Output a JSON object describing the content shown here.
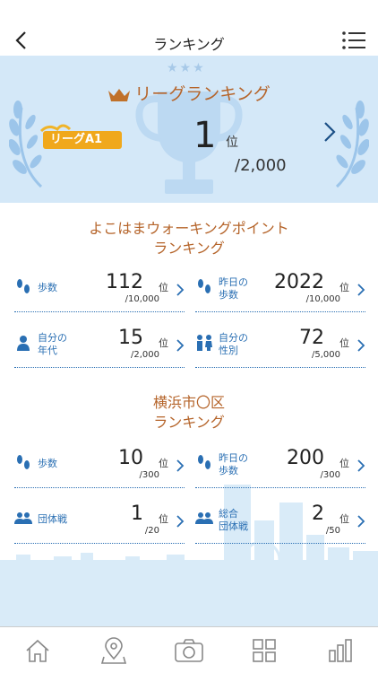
{
  "header": {
    "title": "ランキング"
  },
  "league": {
    "title": "リーグランキング",
    "badge": "リーグA1",
    "rank": "1",
    "rank_unit": "位",
    "total": "/2,000"
  },
  "section_yokohama": {
    "title_line1": "よこはまウォーキングポイント",
    "title_line2": "ランキング",
    "items": [
      {
        "label": "歩数",
        "value": "112",
        "unit": "位",
        "total": "/10,000",
        "icon": "footsteps-icon"
      },
      {
        "label_line1": "昨日の",
        "label_line2": "歩数",
        "value": "2022",
        "unit": "位",
        "total": "/10,000",
        "icon": "footsteps-icon"
      },
      {
        "label_line1": "自分の",
        "label_line2": "年代",
        "value": "15",
        "unit": "位",
        "total": "/2,000",
        "icon": "person-icon"
      },
      {
        "label_line1": "自分の",
        "label_line2": "性別",
        "value": "72",
        "unit": "位",
        "total": "/5,000",
        "icon": "gender-icon"
      }
    ]
  },
  "section_ward": {
    "title_line1": "横浜市〇区",
    "title_line2": "ランキング",
    "items": [
      {
        "label": "歩数",
        "value": "10",
        "unit": "位",
        "total": "/300",
        "icon": "footsteps-icon"
      },
      {
        "label_line1": "昨日の",
        "label_line2": "歩数",
        "value": "200",
        "unit": "位",
        "total": "/300",
        "icon": "footsteps-icon"
      },
      {
        "label": "団体戦",
        "value": "1",
        "unit": "位",
        "total": "/20",
        "icon": "group-icon"
      },
      {
        "label_line1": "総合",
        "label_line2": "団体戦",
        "value": "2",
        "unit": "位",
        "total": "/50",
        "icon": "group-icon"
      }
    ]
  },
  "tabs": [
    "home-icon",
    "map-pin-icon",
    "camera-icon",
    "grid-icon",
    "bar-chart-icon"
  ],
  "colors": {
    "accent_blue": "#2a6fb3",
    "title_orange": "#b5642a",
    "banner_bg": "#d4e8f8"
  }
}
